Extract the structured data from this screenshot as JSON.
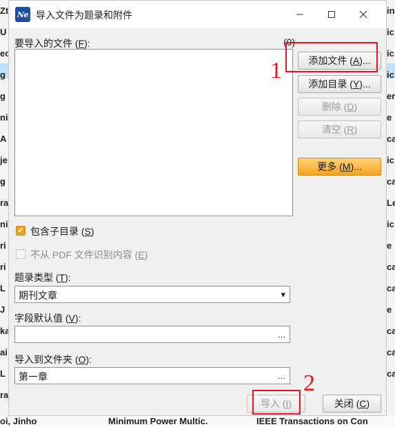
{
  "background": {
    "left_fragments": [
      "Zt",
      "U",
      "ec",
      "g",
      "g",
      "ni",
      "A",
      "je",
      "g",
      "ra",
      "ni",
      "ri",
      "ri",
      "L",
      "J",
      "ka",
      "ai",
      "L",
      "ra"
    ],
    "right_fragments": [
      "in",
      "ic",
      "ic",
      "ic",
      "er",
      "e",
      "ca",
      "ic",
      "ca",
      "Le",
      "ic",
      "e",
      "ca",
      "ca",
      "e",
      "ca",
      "ca",
      "ca"
    ],
    "bottom_text": [
      "oi, Jinho",
      "Minimum Power Multic.",
      "IEEE Transactions on Con"
    ]
  },
  "dialog": {
    "title": "导入文件为题录和附件",
    "icon_text": "Ne",
    "window_controls": {
      "minimize": "—",
      "maximize": "☐",
      "close": "✕"
    },
    "files_label": "要导入的文件 (F):",
    "files_label_pre": "要导入的文件 (",
    "files_label_key": "F",
    "files_label_post": "):",
    "file_count": "(0)",
    "buttons": {
      "add_file": {
        "pre": "添加文件 (",
        "key": "A",
        "post": ")..."
      },
      "add_dir": {
        "pre": "添加目录 (",
        "key": "Y",
        "post": ")..."
      },
      "delete": {
        "pre": "删除 (",
        "key": "D",
        "post": ")"
      },
      "clear": {
        "pre": "清空 (",
        "key": "R",
        "post": ")"
      },
      "more": {
        "pre": "更多 (",
        "key": "M",
        "post": ")..."
      },
      "import": {
        "pre": "导入 (",
        "key": "I",
        "post": ")"
      },
      "close": {
        "pre": "关闭 (",
        "key": "C",
        "post": ")"
      }
    },
    "include_subdirs": {
      "pre": "包含子目录 (",
      "key": "S",
      "post": ")",
      "checked": true
    },
    "no_pdf_content": {
      "pre": "不从 PDF 文件识别内容 (",
      "key": "E",
      "post": ")",
      "checked": false
    },
    "record_type": {
      "pre": "题录类型 (",
      "key": "T",
      "post": "):",
      "value": "期刊文章"
    },
    "field_default": {
      "pre": "字段默认值 (",
      "key": "V",
      "post": "):",
      "value": ""
    },
    "import_folder": {
      "pre": "导入到文件夹 (",
      "key": "O",
      "post": "):",
      "value": "第一章"
    },
    "ellipsis": "...",
    "dropdown_arrow": "▾"
  },
  "annotations": [
    {
      "label": "1"
    },
    {
      "label": "2"
    }
  ],
  "colors": {
    "accent_orange": "#f2a31b",
    "annotation_red": "#e8141d",
    "icon_blue": "#1f4e9c"
  }
}
